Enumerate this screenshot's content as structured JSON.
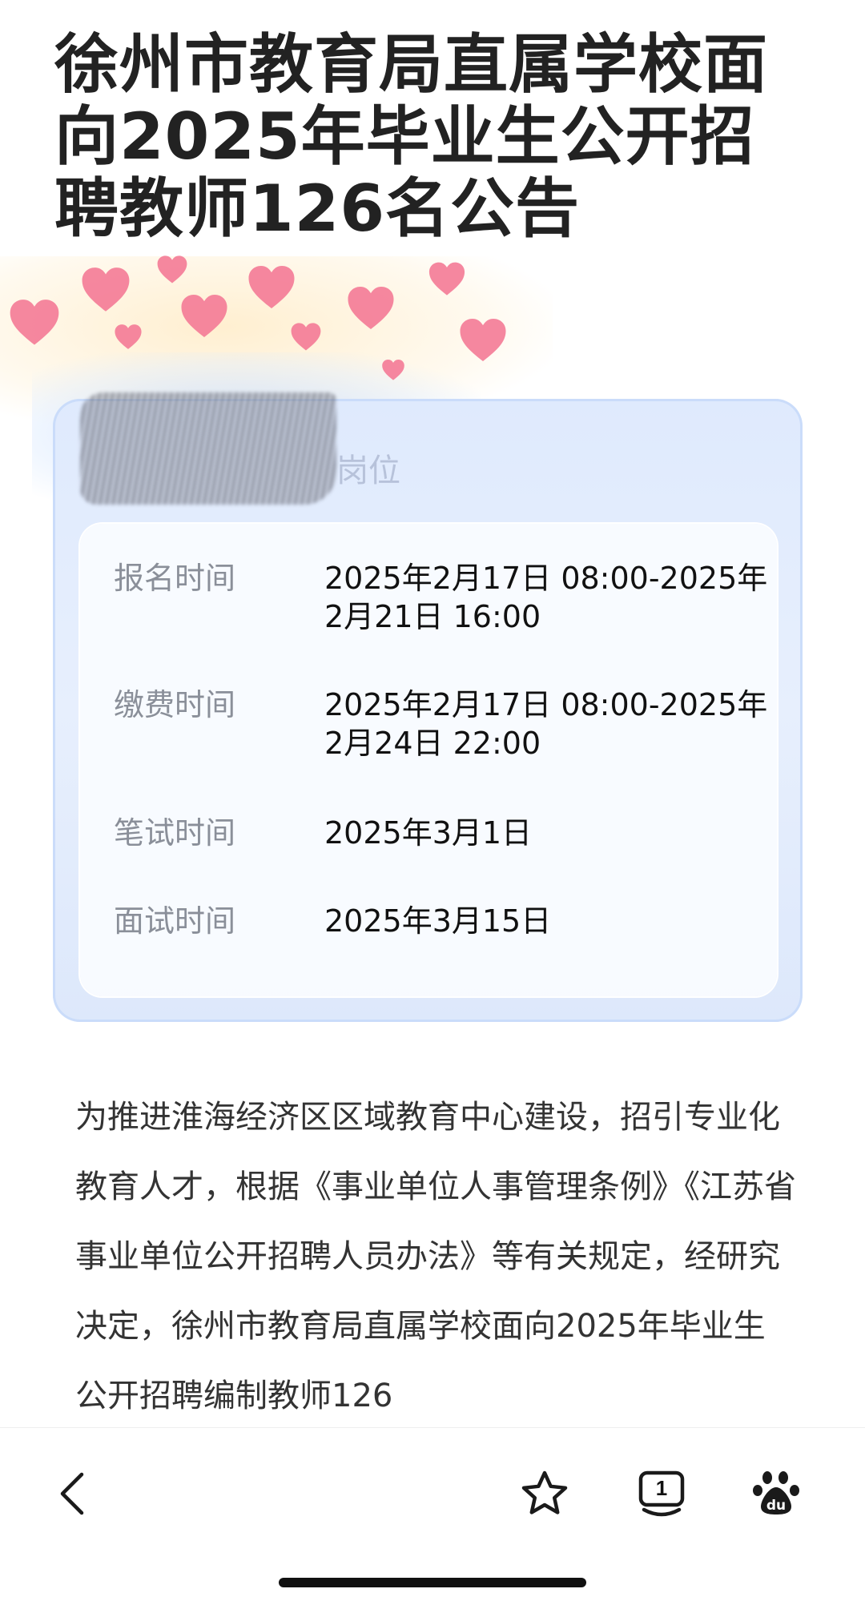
{
  "article": {
    "title": "徐州市教育局直属学校面向2025年毕业生公开招聘教师126名公告",
    "card_header_partial": "岗位"
  },
  "schedule": [
    {
      "label": "报名时间",
      "value": "2025年2月17日 08:00-2025年2月21日 16:00"
    },
    {
      "label": "缴费时间",
      "value": "2025年2月17日 08:00-2025年2月24日 22:00"
    },
    {
      "label": "笔试时间",
      "value": "2025年3月1日"
    },
    {
      "label": "面试时间",
      "value": "2025年3月15日"
    }
  ],
  "body_text": "为推进淮海经济区区域教育中心建设，招引专业化教育人才，根据《事业单位人事管理条例》《江苏省事业单位公开招聘人员办法》等有关规定，经研究决定，徐州市教育局直属学校面向2025年毕业生公开招聘编制教师126",
  "toolbar": {
    "tab_count": "1",
    "icons": [
      "back-icon",
      "star-icon",
      "tabs-icon",
      "baidu-paw-icon"
    ]
  },
  "colors": {
    "heart": "#f47a96",
    "card_bg": "#e3ecfc",
    "label": "#8a8f99"
  }
}
